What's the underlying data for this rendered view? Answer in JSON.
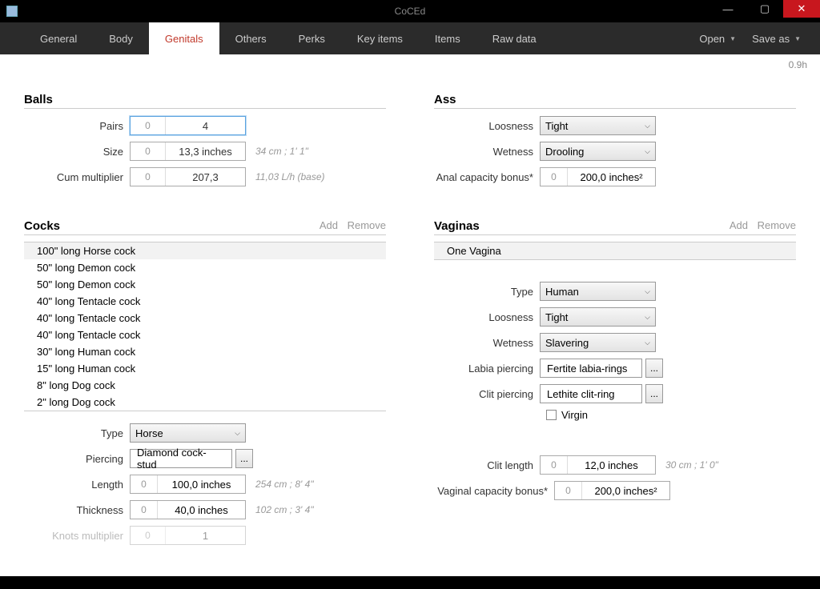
{
  "titlebar": {
    "title": "CoCEd"
  },
  "winbtns": {
    "min": "—",
    "max": "▢",
    "close": "✕"
  },
  "menu": {
    "tabs": [
      "General",
      "Body",
      "Genitals",
      "Others",
      "Perks",
      "Key items",
      "Items",
      "Raw data"
    ],
    "activeIndex": 2,
    "open": "Open",
    "saveas": "Save as"
  },
  "version": "0.9h",
  "balls": {
    "heading": "Balls",
    "pairs_label": "Pairs",
    "pairs_zero": "0",
    "pairs_value": "4",
    "size_label": "Size",
    "size_zero": "0",
    "size_value": "13,3 inches",
    "size_hint": "34 cm ; 1' 1\"",
    "cum_label": "Cum multiplier",
    "cum_zero": "0",
    "cum_value": "207,3",
    "cum_hint": "11,03 L/h (base)"
  },
  "ass": {
    "heading": "Ass",
    "loos_label": "Loosness",
    "loos_value": "Tight",
    "wet_label": "Wetness",
    "wet_value": "Drooling",
    "cap_label": "Anal capacity bonus*",
    "cap_zero": "0",
    "cap_value": "200,0 inches²"
  },
  "cocks": {
    "heading": "Cocks",
    "add": "Add",
    "remove": "Remove",
    "items": [
      "100\" long Horse cock",
      "50\" long Demon cock",
      "50\" long Demon cock",
      "40\" long Tentacle cock",
      "40\" long Tentacle cock",
      "40\" long Tentacle cock",
      "30\" long Human cock",
      "15\" long Human cock",
      "8\" long Dog cock",
      "2\" long Dog cock"
    ],
    "selectedIndex": 0,
    "type_label": "Type",
    "type_value": "Horse",
    "pierce_label": "Piercing",
    "pierce_value": "Diamond cock-stud",
    "len_label": "Length",
    "len_zero": "0",
    "len_value": "100,0 inches",
    "len_hint": "254 cm ; 8' 4\"",
    "thick_label": "Thickness",
    "thick_zero": "0",
    "thick_value": "40,0 inches",
    "thick_hint": "102 cm ; 3' 4\"",
    "knots_label": "Knots multiplier",
    "knots_zero": "0",
    "knots_value": "1"
  },
  "vaginas": {
    "heading": "Vaginas",
    "add": "Add",
    "remove": "Remove",
    "items": [
      "One Vagina"
    ],
    "type_label": "Type",
    "type_value": "Human",
    "loos_label": "Loosness",
    "loos_value": "Tight",
    "wet_label": "Wetness",
    "wet_value": "Slavering",
    "labia_label": "Labia piercing",
    "labia_value": "Fertite labia-rings",
    "clitp_label": "Clit piercing",
    "clitp_value": "Lethite clit-ring",
    "virgin_label": "Virgin",
    "clitlen_label": "Clit length",
    "clitlen_zero": "0",
    "clitlen_value": "12,0 inches",
    "clitlen_hint": "30 cm ; 1' 0\"",
    "cap_label": "Vaginal capacity bonus*",
    "cap_zero": "0",
    "cap_value": "200,0 inches²"
  },
  "ellipsis": "..."
}
